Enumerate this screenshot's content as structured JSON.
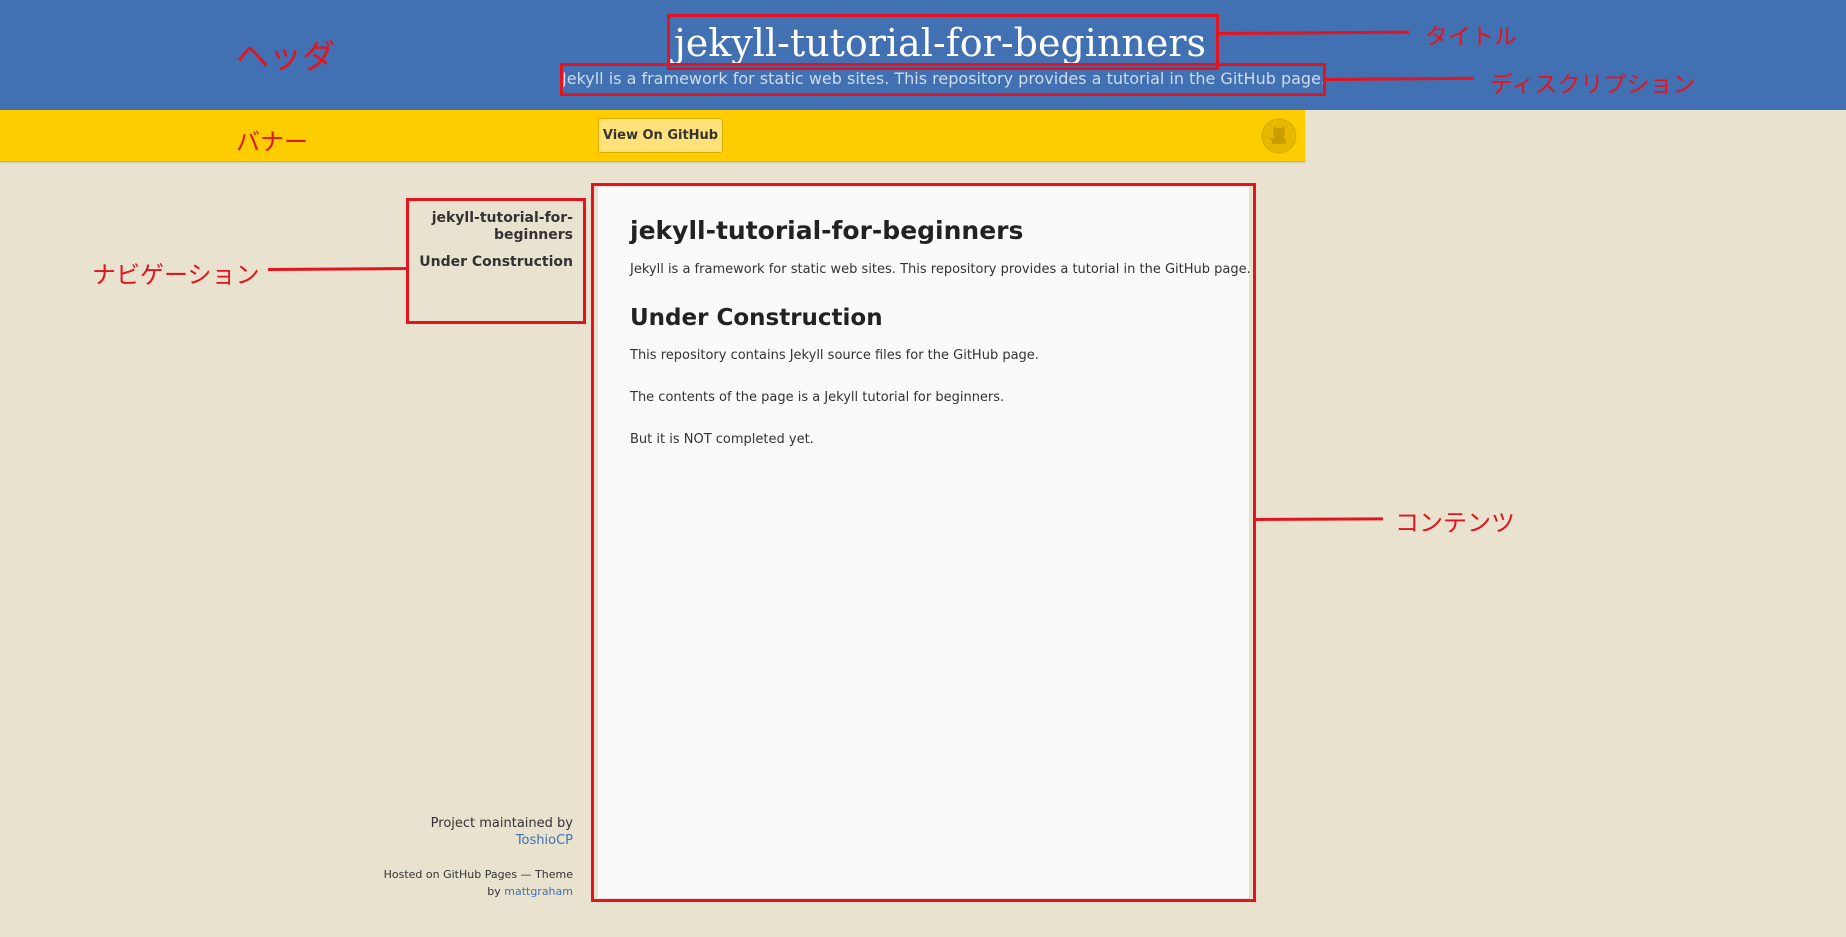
{
  "header": {
    "title": "jekyll-tutorial-for-beginners",
    "description": "Jekyll is a framework for static web sites. This repository provides a tutorial in the GitHub page."
  },
  "banner": {
    "button_label": "View On GitHub",
    "logo_icon": "github-octocat-icon"
  },
  "nav": {
    "items": [
      {
        "label": "jekyll-tutorial-for-beginners"
      },
      {
        "label": "Under Construction"
      }
    ]
  },
  "credits": {
    "maintained_by": "Project maintained by",
    "maintainer": "ToshioCP",
    "hosted_text": "Hosted on GitHub Pages — Theme by",
    "theme_author": "mattgraham"
  },
  "content": {
    "heading": "jekyll-tutorial-for-beginners",
    "intro": "Jekyll is a framework for static web sites. This repository provides a tutorial in the GitHub page.",
    "section_heading": "Under Construction",
    "paragraphs": [
      "This repository contains Jekyll source files for the GitHub page.",
      "The contents of the page is a Jekyll tutorial for beginners.",
      "But it is NOT completed yet."
    ]
  },
  "annotations": {
    "header": "ヘッダ",
    "title": "タイトル",
    "description": "ディスクリプション",
    "banner": "バナー",
    "navigation": "ナビゲーション",
    "content": "コンテンツ"
  },
  "colors": {
    "header_bg": "#4170b3",
    "banner_bg": "#fecd00",
    "page_bg": "#e8e2cf",
    "annotation": "#e3141d"
  }
}
